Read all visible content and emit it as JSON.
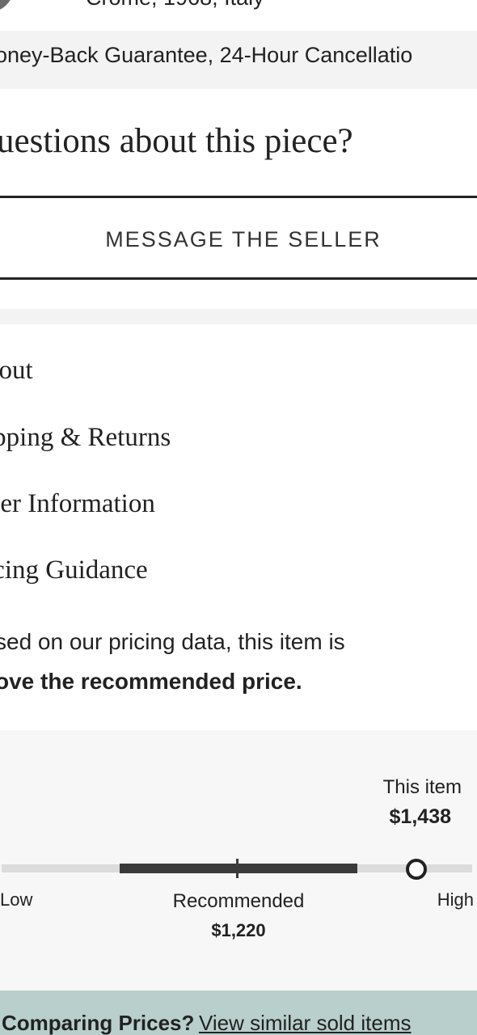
{
  "listing": {
    "meta_fragment": "Crome, 1968, Italy"
  },
  "guarantee": {
    "text": "oney-Back Guarantee, 24-Hour Cancellatio"
  },
  "questions": {
    "heading": "uestions about this piece?",
    "button_label": "MESSAGE THE SELLER"
  },
  "accordion": {
    "items": [
      {
        "label": "bout"
      },
      {
        "label": "ipping & Returns"
      },
      {
        "label": "ller Information"
      },
      {
        "label": "icing Guidance"
      }
    ]
  },
  "pricing": {
    "statement_line1": "sed on our pricing data, this item is",
    "statement_line2": "ove the recommended price.",
    "this_item_label": "This item",
    "this_item_price": "$1,438",
    "low_label": "Low",
    "high_label": "High",
    "recommended_label": "Recommended",
    "recommended_price": "$1,220"
  },
  "compare": {
    "label": "Comparing Prices?",
    "link": "View similar sold items"
  },
  "colors": {
    "compare_bar_bg": "#b8cfcb",
    "panel_bg": "#f7f7f7",
    "range_dark": "#3a3a3a"
  }
}
